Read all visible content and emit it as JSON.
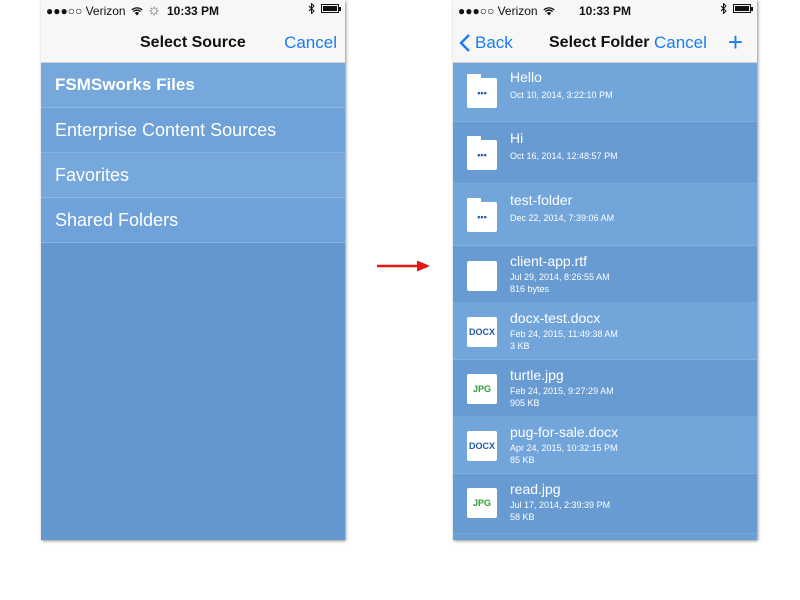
{
  "status_bar": {
    "carrier": "●●●○○ Verizon",
    "time": "10:33 PM"
  },
  "left_screen": {
    "title": "Select Source",
    "cancel_label": "Cancel",
    "sources": [
      {
        "label": "FSMSworks Files"
      },
      {
        "label": "Enterprise Content Sources"
      },
      {
        "label": "Favorites"
      },
      {
        "label": "Shared Folders"
      }
    ]
  },
  "right_screen": {
    "back_label": "Back",
    "title": "Select Folder",
    "cancel_label": "Cancel",
    "add_label": "+",
    "files": [
      {
        "name": "Hello",
        "date": "Oct 10, 2014, 3:22:10 PM",
        "size": "",
        "kind": "folder",
        "icon_text": "•••"
      },
      {
        "name": "Hi",
        "date": "Oct 16, 2014, 12:48:57 PM",
        "size": "",
        "kind": "folder",
        "icon_text": "•••"
      },
      {
        "name": "test-folder",
        "date": "Dec 22, 2014, 7:39:06 AM",
        "size": "",
        "kind": "folder",
        "icon_text": "•••"
      },
      {
        "name": "client-app.rtf",
        "date": "Jul 29, 2014, 8:26:55 AM",
        "size": "816 bytes",
        "kind": "file",
        "icon_text": ""
      },
      {
        "name": "docx-test.docx",
        "date": "Feb 24, 2015, 11:49:38 AM",
        "size": "3 KB",
        "kind": "file",
        "icon_text": "DOCX"
      },
      {
        "name": "turtle.jpg",
        "date": "Feb 24, 2015, 9:27:29 AM",
        "size": "905 KB",
        "kind": "file",
        "icon_text": "JPG"
      },
      {
        "name": "pug-for-sale.docx",
        "date": "Apr 24, 2015, 10:32:15 PM",
        "size": "85 KB",
        "kind": "file",
        "icon_text": "DOCX"
      },
      {
        "name": "read.jpg",
        "date": "Jul 17, 2014, 2:39:39 PM",
        "size": "58 KB",
        "kind": "file",
        "icon_text": "JPG"
      }
    ]
  },
  "colors": {
    "ios_blue": "#1a7cf5",
    "list_blue": "#6a9fd4",
    "docx_text": "#1e5aa8",
    "jpg_text": "#2e9e3a",
    "arrow": "#e3170f"
  }
}
